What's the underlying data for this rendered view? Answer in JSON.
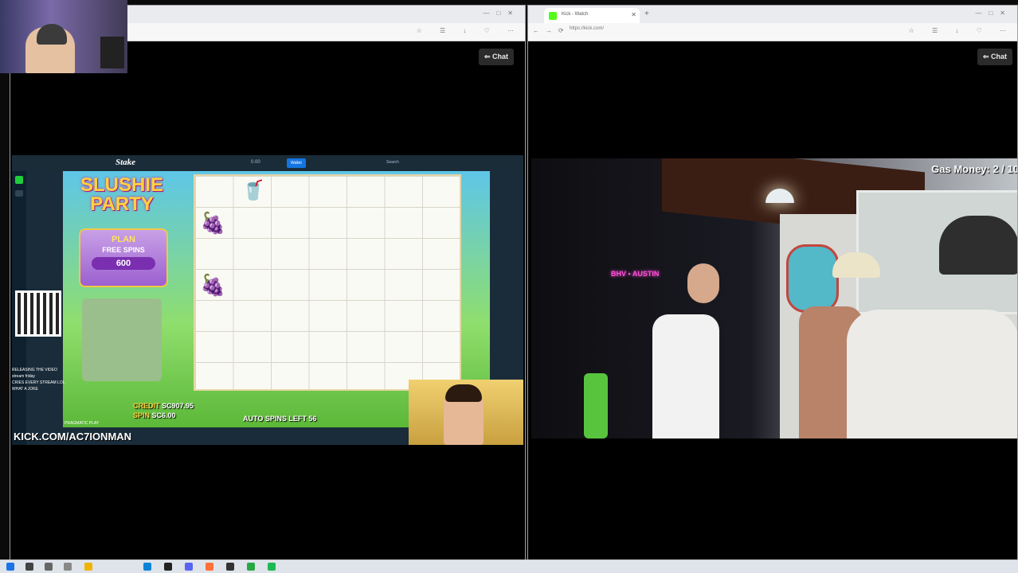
{
  "webcam": {
    "label": "streamer webcam"
  },
  "left_window": {
    "chat_label": "Chat",
    "toolbar_icons": "☆ ☰ ↓ ♡ ⋯",
    "scene": {
      "casino_logo": "Stake",
      "topbar_center": "0.00",
      "wallet_button": "Wallet",
      "search": "Search",
      "game_title_1": "SLUSHIE",
      "game_title_2": "PARTY",
      "freespins_title": "PLAN",
      "freespins_label": "FREE SPINS",
      "freespins_value": "600",
      "credit_label": "CREDIT",
      "credit_value": "SC907.95",
      "bet_label": "SPIN",
      "bet_value": "SC6.00",
      "auto_spins": "AUTO SPINS LEFT 56",
      "provider": "PRAGMATIC PLAY",
      "kick_url": "KICK.COM/AC7IONMAN",
      "chat_lines": [
        "RELEASING THE VIDEO",
        "stream friday",
        "CRIES EVERY STREAM LOL",
        "WHAT A JOKE"
      ]
    }
  },
  "right_window": {
    "tab_title": "Kick - Watch",
    "url": "https://kick.com/",
    "chat_label": "Chat",
    "toolbar_icons": "☆ ☰ ↓ ♡ ⋯",
    "overlay": "Gas Money: 2 / 10",
    "neon_sign": "BHV • AUSTIN"
  },
  "taskbar": {
    "icons": [
      "start-icon",
      "search-icon",
      "task-view-icon",
      "widgets-icon",
      "explorer-icon",
      "edge-icon",
      "terminal-icon",
      "discord-icon",
      "firefox-icon",
      "obs-icon",
      "app-icon",
      "spotify-icon"
    ],
    "colors": [
      "#1a73e8",
      "#444444",
      "#666666",
      "#888888",
      "#f0b400",
      "#0b84d8",
      "#222222",
      "#5865f2",
      "#ff7139",
      "#333333",
      "#27a844",
      "#1db954"
    ]
  }
}
